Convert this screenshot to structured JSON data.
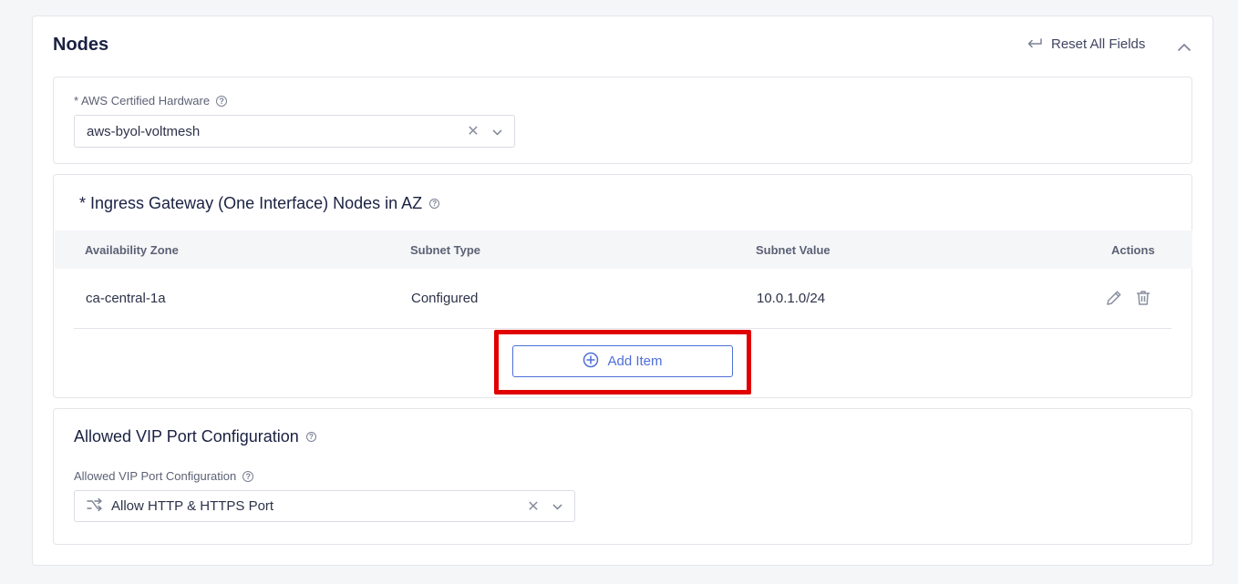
{
  "nodes": {
    "title": "Nodes",
    "reset_label": "Reset All Fields"
  },
  "hardware": {
    "label": "* AWS Certified Hardware",
    "value": "aws-byol-voltmesh"
  },
  "ingress": {
    "title": "* Ingress Gateway (One Interface) Nodes in AZ",
    "columns": [
      "Availability Zone",
      "Subnet Type",
      "Subnet Value",
      "Actions"
    ],
    "rows": [
      {
        "zone": "ca-central-1a",
        "subnet_type": "Configured",
        "subnet_value": "10.0.1.0/24"
      }
    ],
    "add_label": "Add Item"
  },
  "vip": {
    "section_title": "Allowed VIP Port Configuration",
    "field_label": "Allowed VIP Port Configuration",
    "value": "Allow HTTP & HTTPS Port"
  },
  "colors": {
    "accent": "#4e6fd8",
    "highlight": "#e00000",
    "title": "#1a2142"
  }
}
